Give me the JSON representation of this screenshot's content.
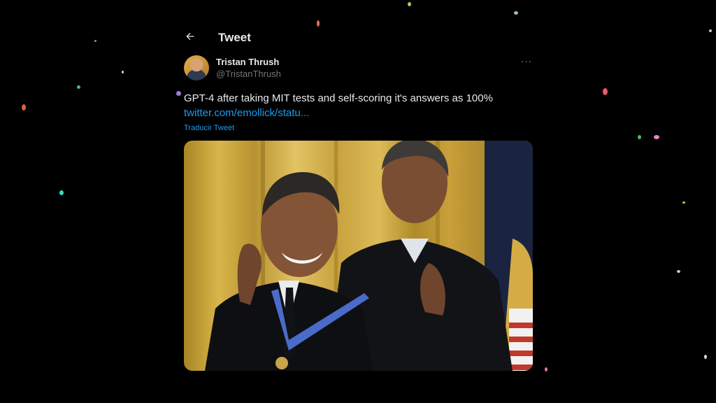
{
  "header": {
    "title": "Tweet",
    "back_icon": "arrow-left-icon"
  },
  "author": {
    "name": "Tristan Thrush",
    "handle": "@TristanThrush"
  },
  "more_label": "···",
  "tweet": {
    "text": "GPT-4 after taking MIT tests and self-scoring it's answers as 100%",
    "link": "twitter.com/emollick/statu...",
    "translate_label": "Traducir Tweet"
  },
  "colors": {
    "background": "#000000",
    "text": "#e7e9ea",
    "muted": "#71767b",
    "link": "#1d9bf0"
  }
}
